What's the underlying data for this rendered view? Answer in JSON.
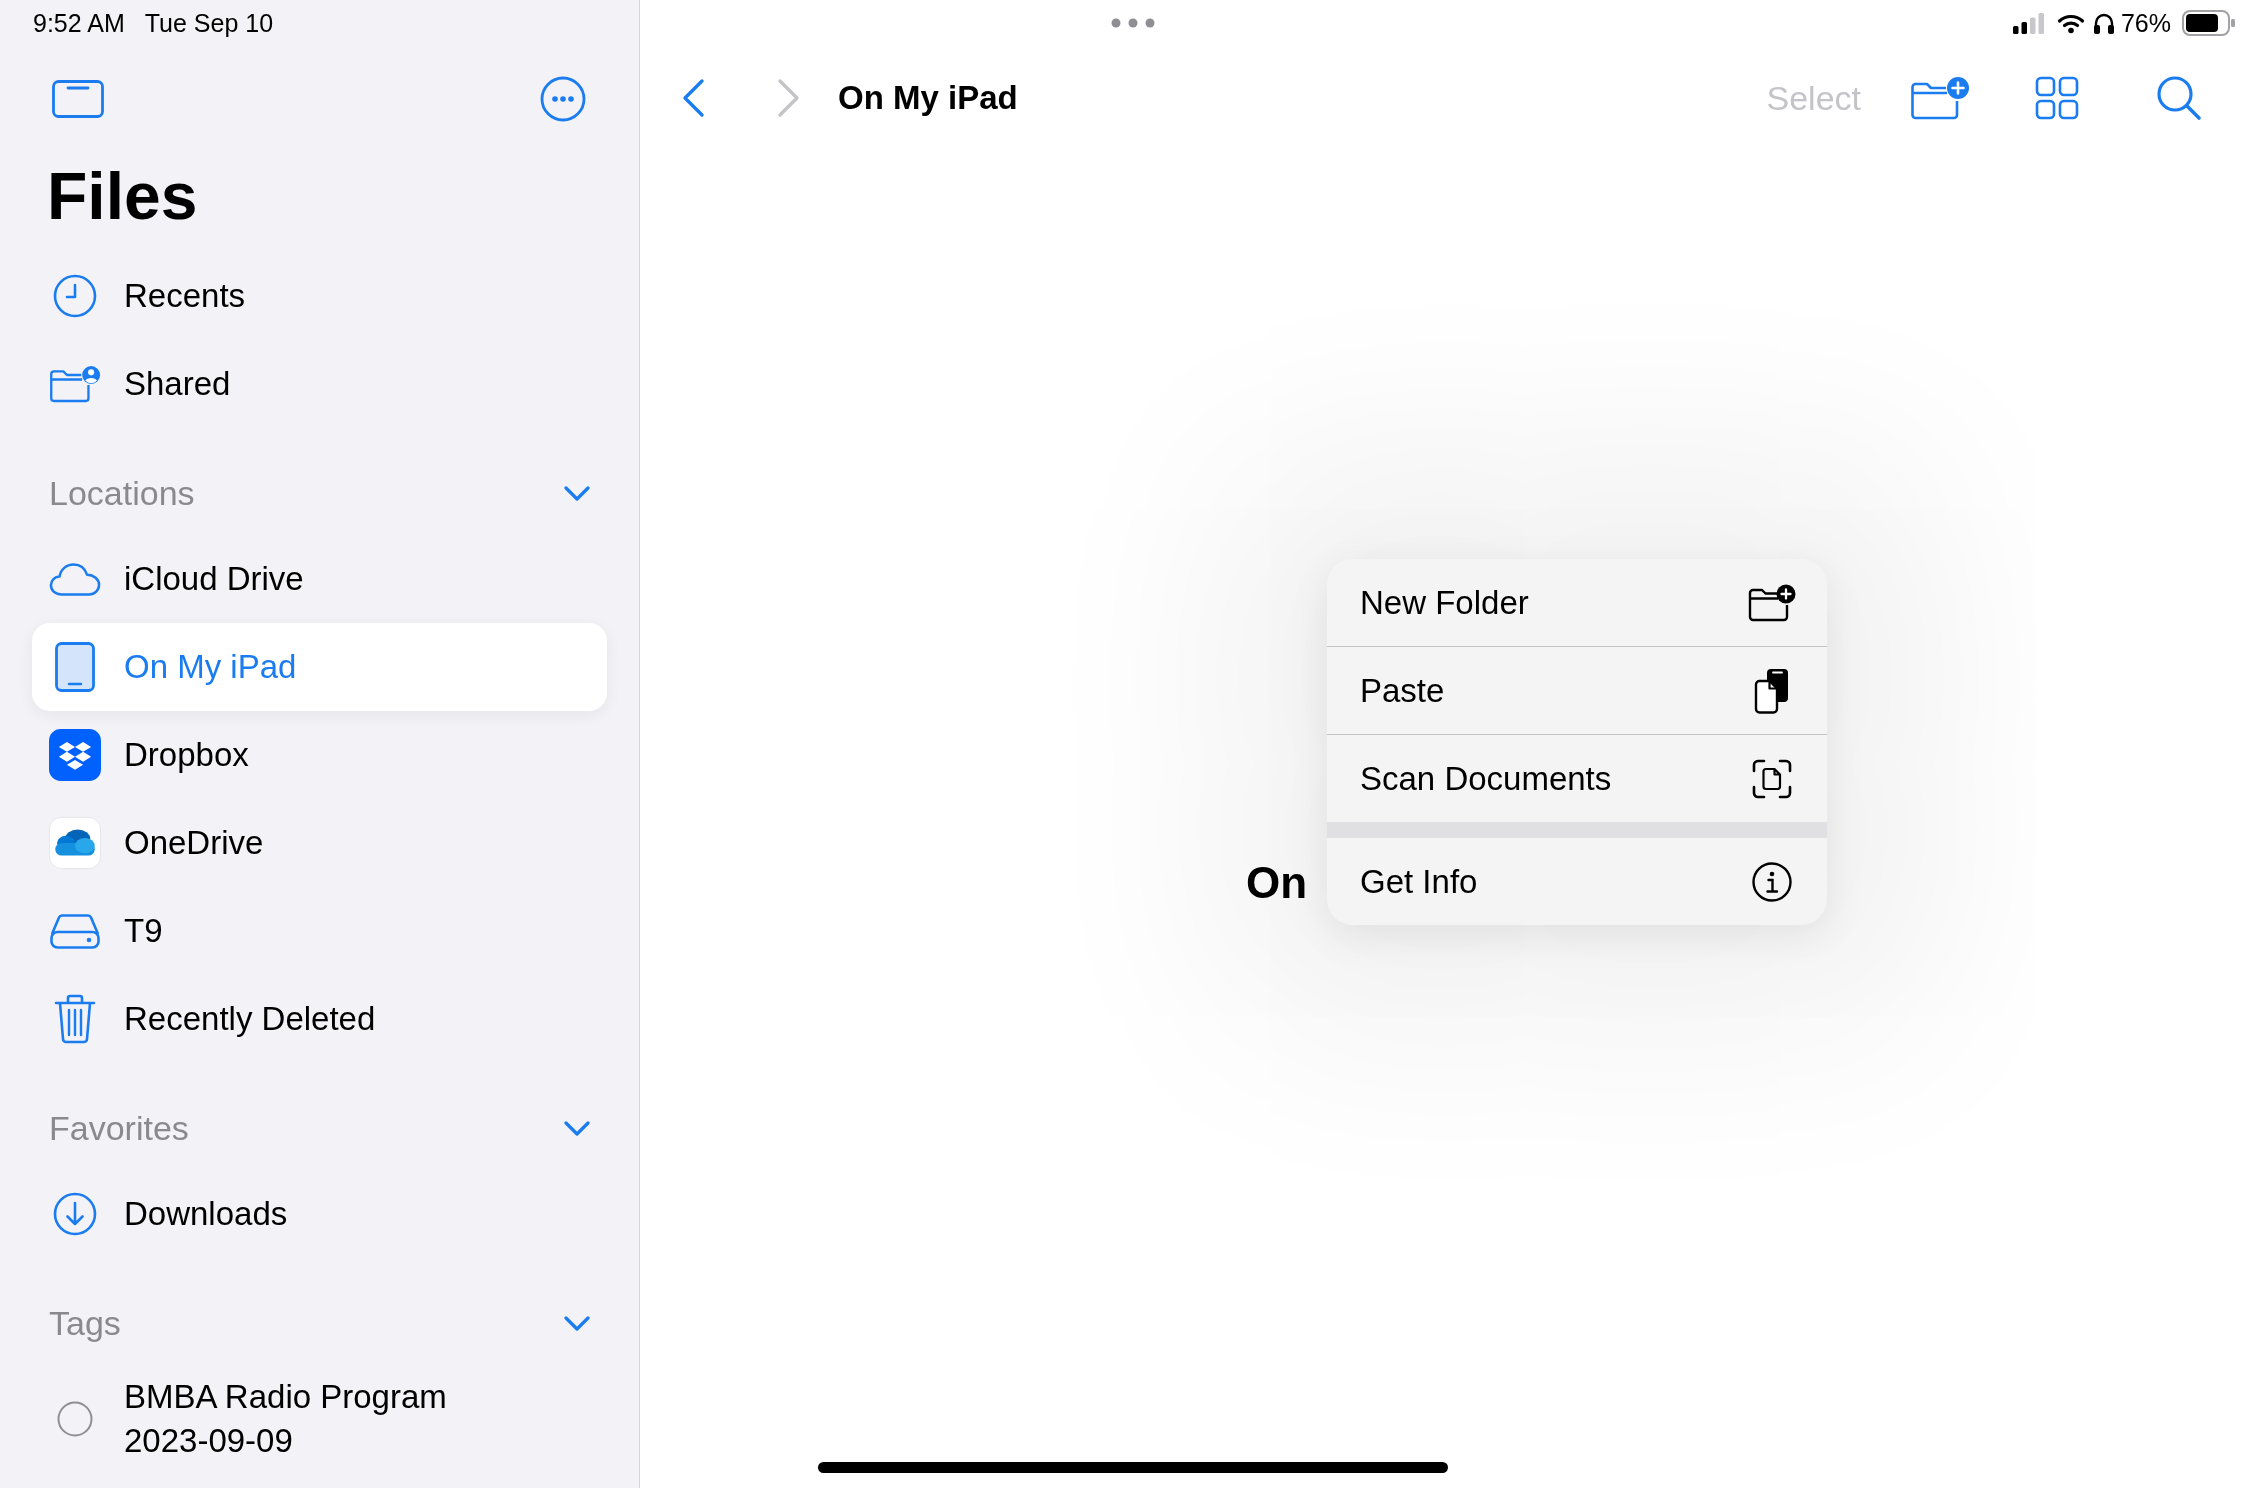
{
  "status_bar": {
    "time": "9:52 AM",
    "date": "Tue Sep 10",
    "battery_percent": "76%"
  },
  "sidebar": {
    "title": "Files",
    "items": [
      {
        "kind": "recents",
        "label": "Recents",
        "selected": false
      },
      {
        "kind": "shared",
        "label": "Shared",
        "selected": false
      }
    ],
    "sections": [
      {
        "title": "Locations",
        "expanded": true,
        "items": [
          {
            "kind": "icloud",
            "label": "iCloud Drive",
            "selected": false
          },
          {
            "kind": "device",
            "label": "On My iPad",
            "selected": true
          },
          {
            "kind": "dropbox",
            "label": "Dropbox",
            "selected": false
          },
          {
            "kind": "onedrive",
            "label": "OneDrive",
            "selected": false
          },
          {
            "kind": "external",
            "label": "T9",
            "selected": false
          },
          {
            "kind": "trash",
            "label": "Recently Deleted",
            "selected": false
          }
        ]
      },
      {
        "title": "Favorites",
        "expanded": true,
        "items": [
          {
            "kind": "downloads",
            "label": "Downloads",
            "selected": false
          }
        ]
      },
      {
        "title": "Tags",
        "expanded": true,
        "items": [
          {
            "kind": "tag",
            "label": "BMBA Radio Program 2023-09-09",
            "selected": false
          }
        ]
      }
    ]
  },
  "toolbar": {
    "back": {
      "disabled": false
    },
    "forward": {
      "disabled": true
    },
    "title": "On My iPad",
    "select": {
      "label": "Select",
      "disabled": true
    }
  },
  "content": {
    "empty_title": "On"
  },
  "context_menu": {
    "groups": [
      [
        {
          "kind": "new_folder",
          "label": "New Folder"
        },
        {
          "kind": "paste",
          "label": "Paste"
        },
        {
          "kind": "scan",
          "label": "Scan Documents"
        }
      ],
      [
        {
          "kind": "info",
          "label": "Get Info"
        }
      ]
    ]
  }
}
